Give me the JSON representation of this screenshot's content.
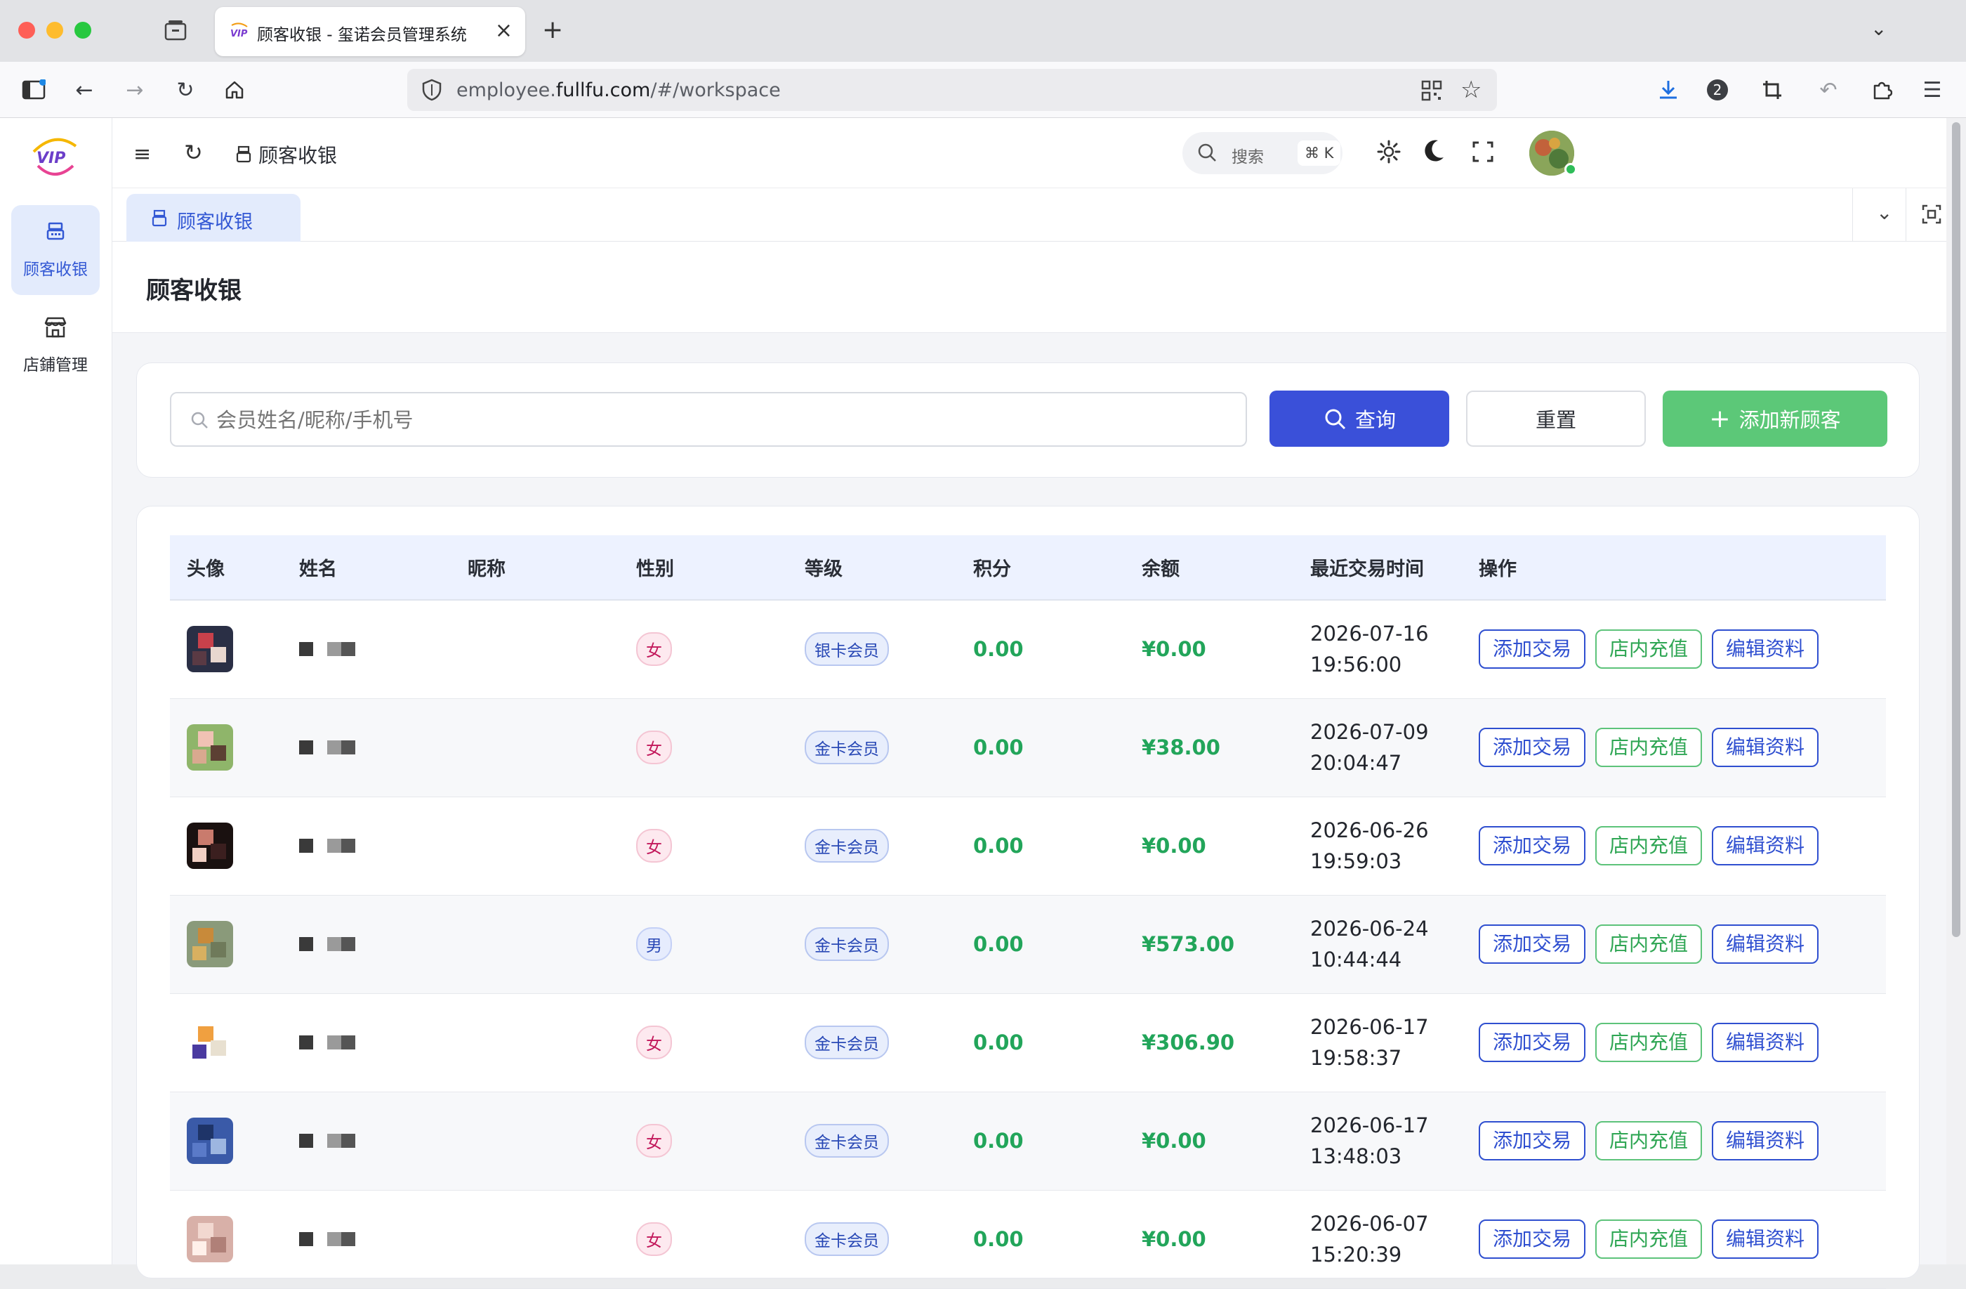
{
  "browser": {
    "tab_title": "顾客收银 - 玺诺会员管理系统",
    "url_prefix": "employee.",
    "url_domain": "fullfu.com",
    "url_path": "/#/workspace",
    "notification_count": "2"
  },
  "sidebar": {
    "logo_text": "VIP",
    "items": [
      {
        "label": "顾客收银",
        "icon": "cash-register-icon",
        "active": true
      },
      {
        "label": "店鋪管理",
        "icon": "store-icon",
        "active": false
      }
    ]
  },
  "header": {
    "breadcrumb": "顾客收银",
    "search_label": "搜索",
    "search_shortcut": "⌘ K"
  },
  "tabs": [
    {
      "label": "顾客收银"
    }
  ],
  "page": {
    "title": "顾客收银"
  },
  "filter": {
    "search_placeholder": "会员姓名/昵称/手机号",
    "query_label": "查询",
    "reset_label": "重置",
    "add_label": "添加新顾客"
  },
  "table": {
    "columns": [
      "头像",
      "姓名",
      "昵称",
      "性别",
      "等级",
      "积分",
      "余额",
      "最近交易时间",
      "操作"
    ],
    "actions": [
      "添加交易",
      "店内充值",
      "编辑资料"
    ],
    "rows": [
      {
        "gender": "女",
        "level": "银卡会员",
        "points": "0.00",
        "balance": "¥0.00",
        "date": "2026-07-16",
        "time": "19:56:00"
      },
      {
        "gender": "女",
        "level": "金卡会员",
        "points": "0.00",
        "balance": "¥38.00",
        "date": "2026-07-09",
        "time": "20:04:47"
      },
      {
        "gender": "女",
        "level": "金卡会员",
        "points": "0.00",
        "balance": "¥0.00",
        "date": "2026-06-26",
        "time": "19:59:03"
      },
      {
        "gender": "男",
        "level": "金卡会员",
        "points": "0.00",
        "balance": "¥573.00",
        "date": "2026-06-24",
        "time": "10:44:44"
      },
      {
        "gender": "女",
        "level": "金卡会员",
        "points": "0.00",
        "balance": "¥306.90",
        "date": "2026-06-17",
        "time": "19:58:37"
      },
      {
        "gender": "女",
        "level": "金卡会员",
        "points": "0.00",
        "balance": "¥0.00",
        "date": "2026-06-17",
        "time": "13:48:03"
      },
      {
        "gender": "女",
        "level": "金卡会员",
        "points": "0.00",
        "balance": "¥0.00",
        "date": "2026-06-07",
        "time": "15:20:39"
      }
    ]
  },
  "colors": {
    "primary": "#3a50d9",
    "success": "#5cc878",
    "amount": "#22a55a"
  }
}
